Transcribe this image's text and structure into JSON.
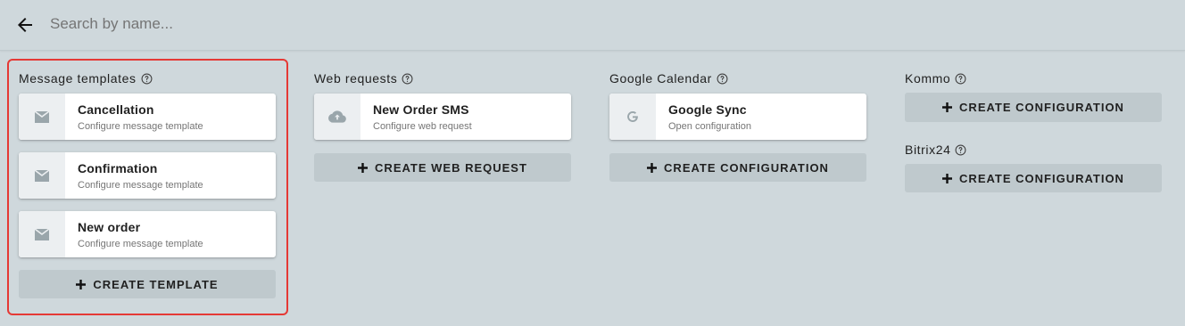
{
  "search": {
    "placeholder": "Search by name..."
  },
  "icons": {
    "back": "arrow-left-icon",
    "help": "help-circle-icon",
    "mail": "mail-icon",
    "cloud": "cloud-icon",
    "google": "google-icon",
    "plus": "plus-icon"
  },
  "colors": {
    "highlight": "#e53935",
    "background": "#cfd8dc",
    "button": "#bfc9cd"
  },
  "columns": [
    {
      "title": "Message templates",
      "cards": [
        {
          "title": "Cancellation",
          "subtitle": "Configure message template"
        },
        {
          "title": "Confirmation",
          "subtitle": "Configure message template"
        },
        {
          "title": "New order",
          "subtitle": "Configure message template"
        }
      ],
      "create_label": "CREATE TEMPLATE"
    },
    {
      "title": "Web requests",
      "cards": [
        {
          "title": "New Order SMS",
          "subtitle": "Configure web request"
        }
      ],
      "create_label": "CREATE WEB REQUEST"
    },
    {
      "title": "Google Calendar",
      "cards": [
        {
          "title": "Google Sync",
          "subtitle": "Open configuration"
        }
      ],
      "create_label": "CREATE CONFIGURATION"
    },
    {
      "sections": [
        {
          "title": "Kommo",
          "create_label": "CREATE CONFIGURATION"
        },
        {
          "title": "Bitrix24",
          "create_label": "CREATE CONFIGURATION"
        }
      ]
    }
  ]
}
